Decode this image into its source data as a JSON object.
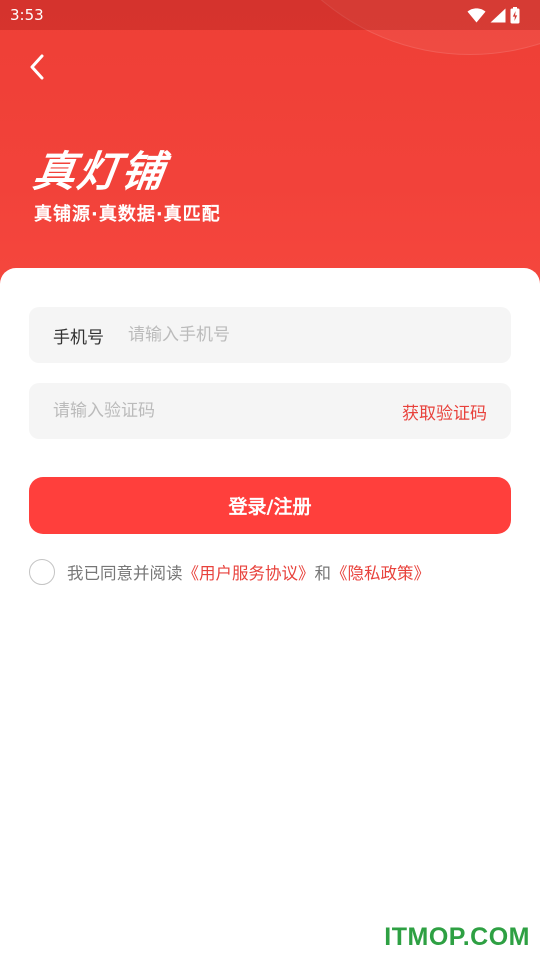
{
  "status_bar": {
    "time": "3:53",
    "icons": [
      "wifi-icon",
      "cellular-signal-icon",
      "battery-icon"
    ]
  },
  "header": {
    "back_icon": "chevron-left-icon",
    "brand": "真灯铺",
    "slogan": "真铺源·真数据·真匹配"
  },
  "form": {
    "phone": {
      "label": "手机号",
      "placeholder": "请输入手机号",
      "value": ""
    },
    "code": {
      "placeholder": "请输入验证码",
      "value": "",
      "get_code_label": "获取验证码"
    },
    "login_label": "登录/注册",
    "agreement": {
      "checked": false,
      "prefix": "我已同意并阅读",
      "terms_link": "《用户服务协议》",
      "and": "和",
      "privacy_link": "《隐私政策》"
    }
  },
  "watermark": "ITMOP.COM",
  "colors": {
    "brand_red": "#ee3f36",
    "button_red": "#ff3f3c",
    "link_red": "#e8423c",
    "input_bg": "#f5f5f5",
    "watermark_green": "#2ea043"
  }
}
